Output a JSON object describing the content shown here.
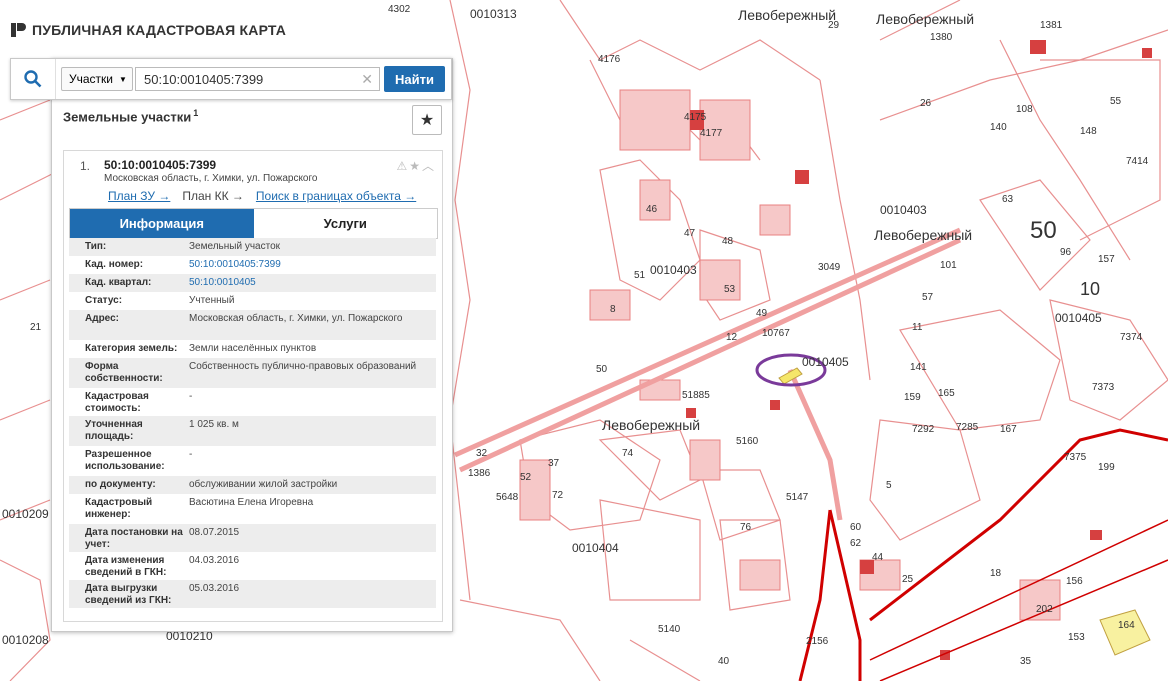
{
  "app": {
    "title": "ПУБЛИЧНАЯ КАДАСТРОВАЯ КАРТА"
  },
  "search": {
    "type_label": "Участки",
    "query": "50:10:0010405:7399",
    "button_label": "Найти"
  },
  "results": {
    "section_title": "Земельные участки",
    "count": "1",
    "item": {
      "number": "1.",
      "cad_number": "50:10:0010405:7399",
      "address": "Московская область, г. Химки, ул. Пожарского",
      "links": {
        "plan_zu": "План ЗУ →",
        "plan_kk": "План КК →",
        "search_in_bounds": "Поиск в границах объекта →"
      },
      "tabs": {
        "info": "Информация",
        "services": "Услуги"
      },
      "properties": [
        {
          "label": "Тип:",
          "value": "Земельный участок"
        },
        {
          "label": "Кад. номер:",
          "value": "50:10:0010405:7399"
        },
        {
          "label": "Кад. квартал:",
          "value": "50:10:0010405"
        },
        {
          "label": "Статус:",
          "value": "Учтенный"
        },
        {
          "label": "Адрес:",
          "value": "Московская область, г. Химки, ул. Пожарского"
        },
        {
          "label": "Категория земель:",
          "value": "Земли населённых пунктов"
        },
        {
          "label": "Форма собственности:",
          "value": "Собственность публично-правовых образований"
        },
        {
          "label": "Кадастровая стоимость:",
          "value": "-"
        },
        {
          "label": "Уточненная площадь:",
          "value": "1 025 кв. м"
        },
        {
          "label": "Разрешенное использование:",
          "value": "-"
        },
        {
          "label": "по документу:",
          "value": "обслуживании жилой застройки"
        },
        {
          "label": "Кадастровый инженер:",
          "value": "Васютина Елена Игоревна"
        },
        {
          "label": "Дата постановки на учет:",
          "value": "08.07.2015"
        },
        {
          "label": "Дата изменения сведений в ГКН:",
          "value": "04.03.2016"
        },
        {
          "label": "Дата выгрузки сведений из ГКН:",
          "value": "05.03.2016"
        }
      ]
    }
  },
  "map": {
    "district_label": "Левобережный",
    "large_quarter": "50",
    "quarter_labels": [
      "0010313",
      "0010403",
      "0010405",
      "0010404",
      "0010209",
      "0010210",
      "0010208"
    ],
    "parcel_labels": [
      "4302",
      "29",
      "1380",
      "1381",
      "4176",
      "4175",
      "4177",
      "26",
      "108",
      "148",
      "55",
      "140",
      "7414",
      "63",
      "96",
      "157",
      "10",
      "7374",
      "7373",
      "7375",
      "199",
      "46",
      "47",
      "48",
      "51",
      "53",
      "8",
      "50",
      "76",
      "74",
      "72",
      "37",
      "52",
      "5648",
      "32",
      "2156",
      "164",
      "156",
      "202",
      "153",
      "40",
      "35",
      "5160",
      "5147",
      "51885",
      "10767",
      "3049",
      "101",
      "57",
      "11",
      "141",
      "159",
      "165",
      "167",
      "7285",
      "7292",
      "5",
      "49",
      "12",
      "21",
      "5140",
      "73",
      "60",
      "62",
      "44",
      "25",
      "18",
      "1386"
    ],
    "colors": {
      "parcel_line": "#e88080",
      "parcel_fill": "#f6c8c8",
      "boundary": "#d00000",
      "selection_ring": "#7a3a9a",
      "selected_parcel": "#f5e66a"
    }
  }
}
